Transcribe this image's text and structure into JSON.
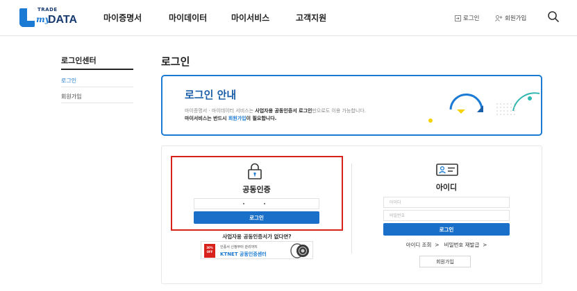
{
  "header": {
    "logo_trade": "TRADE",
    "logo_my": "my",
    "logo_data": "DATA",
    "nav": [
      "마이증명서",
      "마이데이터",
      "마이서비스",
      "고객지원"
    ],
    "login_link": "로그인",
    "signup_link": "회원가입"
  },
  "sidebar": {
    "title": "로그인센터",
    "items": [
      "로그인",
      "회원가입"
    ]
  },
  "page_title": "로그인",
  "notice": {
    "title": "로그인 안내",
    "line1_pre": "마이증명서 · 마이데이터 서비스는 ",
    "line1_bold": "사업자용 공동인증서 로그인",
    "line1_post": "만으로도 이용 가능합니다.",
    "line2_pre": "마이서비스는 반드시 ",
    "line2_hl": "회원가입",
    "line2_post": "이 필요합니다."
  },
  "cert_login": {
    "title": "공동인증",
    "button": "로그인",
    "no_cert_text": "사업자용 공동인증서가 없다면?",
    "ktnet_line1": "인증서 신청부터 관리까지",
    "ktnet_line2": "KTNET 공동인증센터",
    "ktnet_badge": "30% OFF"
  },
  "id_login": {
    "title": "아이디",
    "id_placeholder": "아이디",
    "pw_placeholder": "비밀번호",
    "button": "로그인",
    "find_id": "아이디 조회",
    "reset_pw": "비밀번호 재발급",
    "signup_button": "회원가입"
  },
  "colors": {
    "brand_blue": "#1a6fc9",
    "highlight_red": "#d9211c",
    "navy": "#163a70"
  }
}
